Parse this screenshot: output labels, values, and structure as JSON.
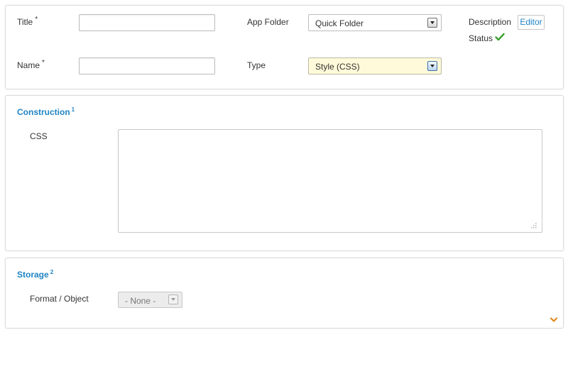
{
  "form": {
    "title_label": "Title",
    "name_label": "Name",
    "required_marker": "*",
    "title_value": "",
    "name_value": "",
    "app_folder_label": "App Folder",
    "app_folder_value": "Quick Folder",
    "type_label": "Type",
    "type_value": "Style (CSS)",
    "description_label": "Description",
    "editor_button_label": "Editor",
    "status_label": "Status",
    "status_icon": "check-icon",
    "status_color": "#3aa12e"
  },
  "construction": {
    "title": "Construction",
    "footnote": "1",
    "css_label": "CSS",
    "css_value": ""
  },
  "storage": {
    "title": "Storage",
    "footnote": "2",
    "format_label": "Format / Object",
    "format_value": "- None -",
    "expand_icon": "chevron-down-icon"
  },
  "colors": {
    "accent": "#1f84c4",
    "select_highlight": "#fffad9",
    "chevron": "#e08a1e"
  }
}
